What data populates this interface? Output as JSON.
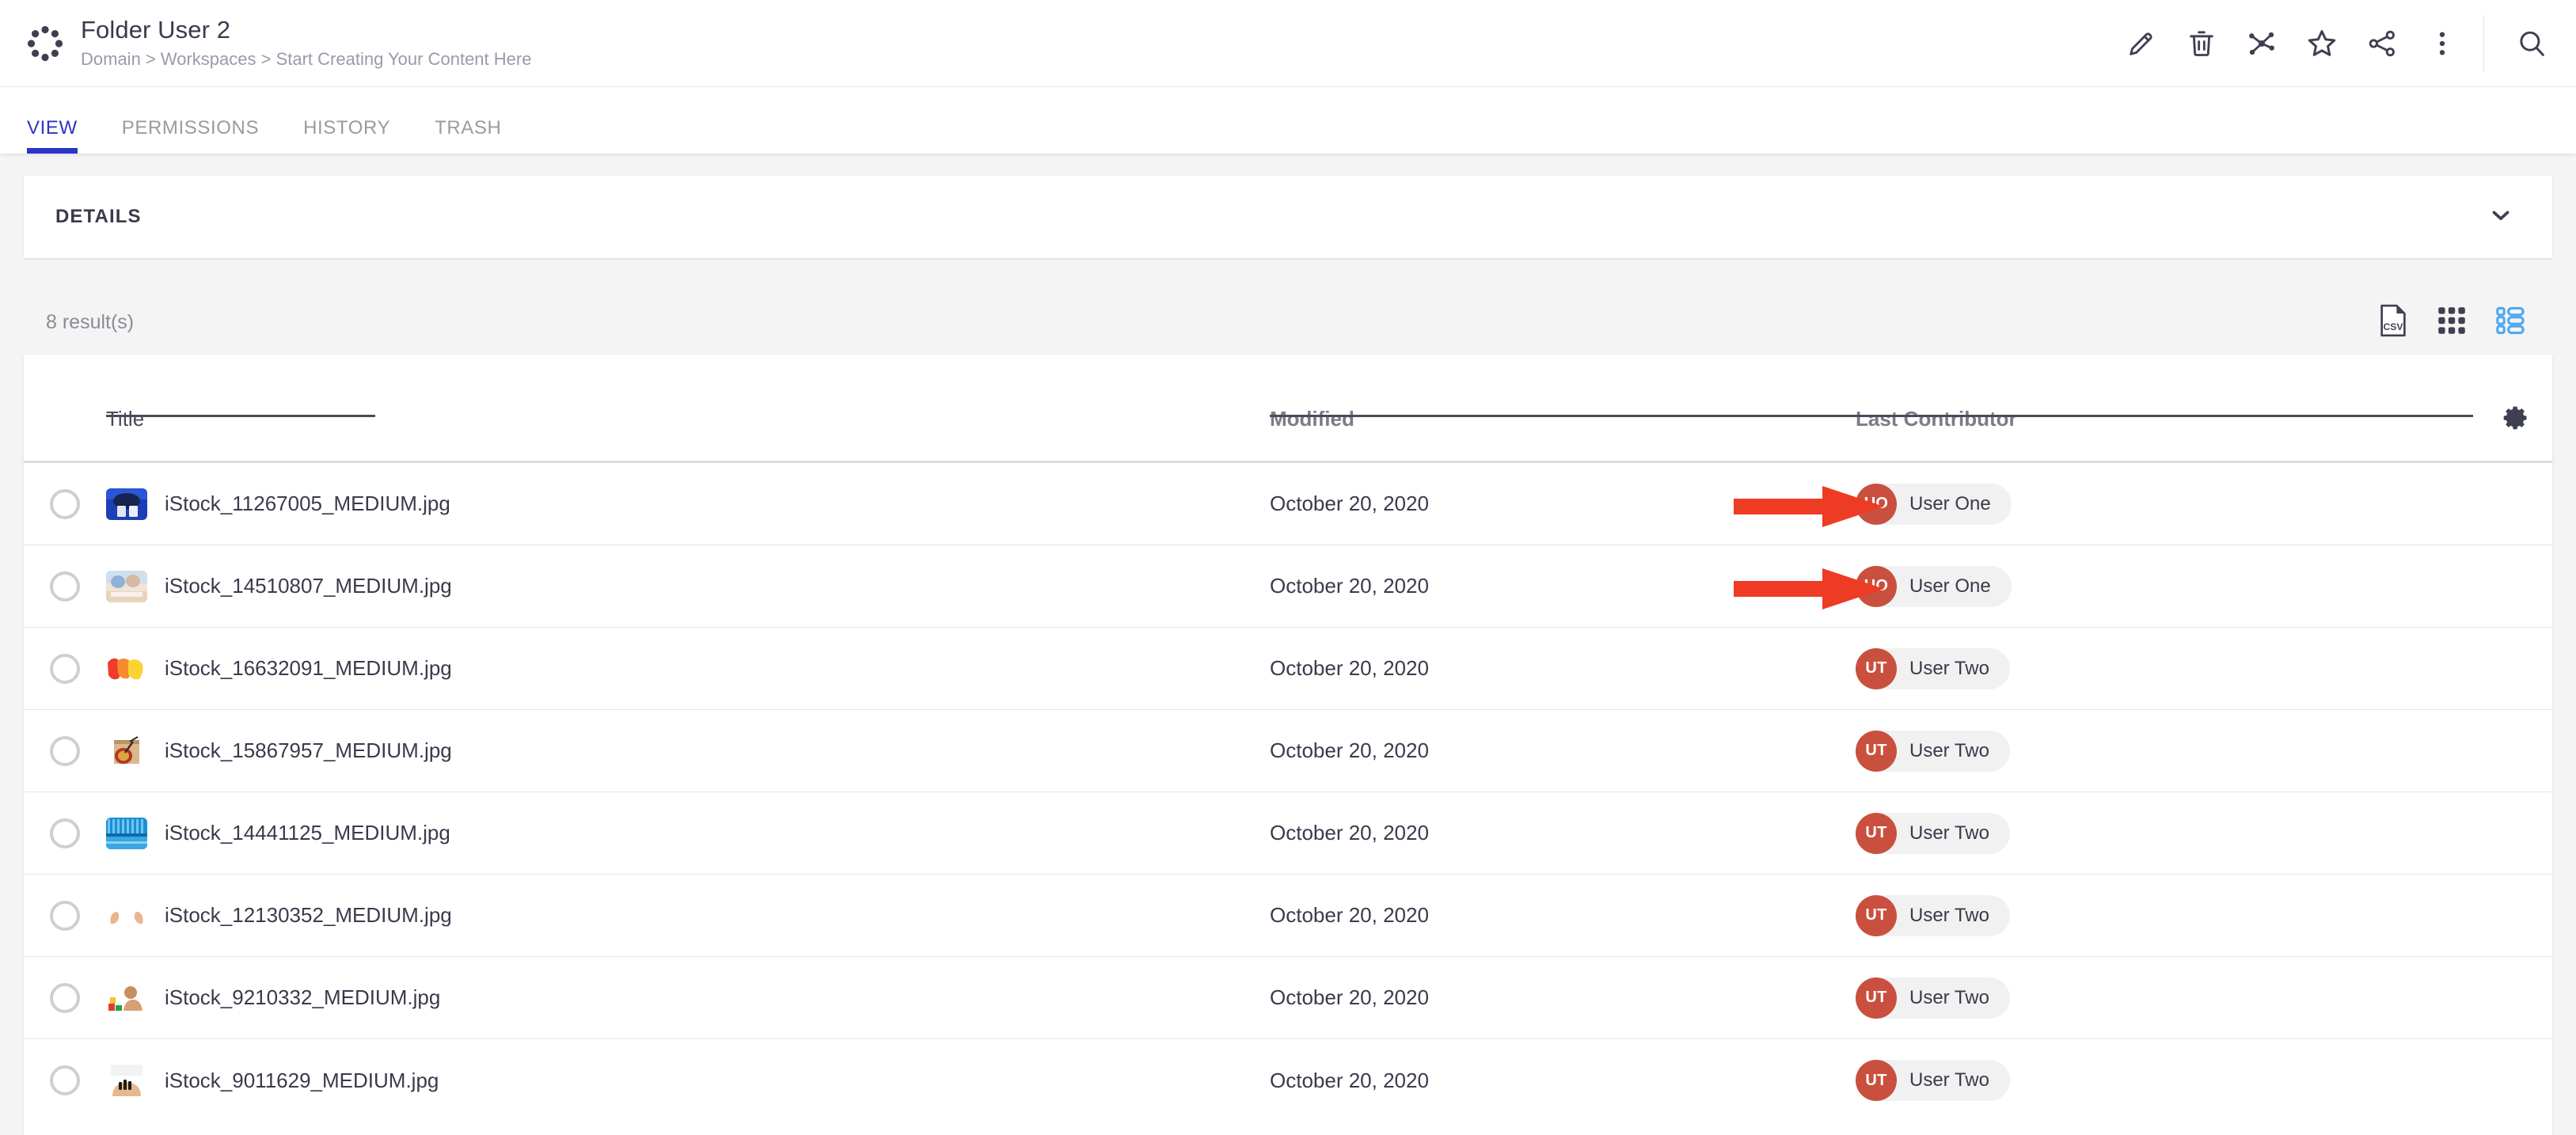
{
  "header": {
    "icon": "workspace-dots-icon",
    "title": "Folder User 2",
    "breadcrumb": "Domain > Workspaces > Start Creating Your Content Here",
    "actions": [
      {
        "name": "edit-button",
        "icon": "pencil-icon",
        "label": "Edit"
      },
      {
        "name": "delete-button",
        "icon": "trash-icon",
        "label": "Delete"
      },
      {
        "name": "relations-button",
        "icon": "network-icon",
        "label": "Relations"
      },
      {
        "name": "favorite-button",
        "icon": "star-icon",
        "label": "Favorite"
      },
      {
        "name": "share-button",
        "icon": "share-icon",
        "label": "Share"
      },
      {
        "name": "more-button",
        "icon": "more-vertical-icon",
        "label": "More"
      },
      {
        "name": "search-button",
        "icon": "search-icon",
        "label": "Search"
      }
    ]
  },
  "tabs": [
    {
      "label": "VIEW",
      "active": true
    },
    {
      "label": "PERMISSIONS",
      "active": false
    },
    {
      "label": "HISTORY",
      "active": false
    },
    {
      "label": "TRASH",
      "active": false
    }
  ],
  "details": {
    "label": "DETAILS",
    "collapse_icon": "chevron-down-icon"
  },
  "results": {
    "count_label": "8 result(s)",
    "tools": [
      {
        "name": "export-csv-button",
        "icon": "csv-file-icon",
        "label": "CSV",
        "active": false
      },
      {
        "name": "grid-view-button",
        "icon": "grid-icon",
        "active": false
      },
      {
        "name": "list-view-button",
        "icon": "list-icon",
        "active": true
      }
    ]
  },
  "table": {
    "columns": [
      {
        "key": "title",
        "label": "Title",
        "sortable": true,
        "underline": true
      },
      {
        "key": "modified",
        "label": "Modified",
        "sortable": true,
        "underline": true
      },
      {
        "key": "contributor",
        "label": "Last Contributor",
        "sortable": true,
        "underline": true
      }
    ],
    "settings_icon": "gear-icon",
    "rows": [
      {
        "title": "iStock_11267005_MEDIUM.jpg",
        "modified": "October 20, 2020",
        "contributor": {
          "initials": "UO",
          "name": "User One"
        },
        "thumb": "dark-blue-objects",
        "annotated": true
      },
      {
        "title": "iStock_14510807_MEDIUM.jpg",
        "modified": "October 20, 2020",
        "contributor": {
          "initials": "UO",
          "name": "User One"
        },
        "thumb": "children-drawing",
        "annotated": true
      },
      {
        "title": "iStock_16632091_MEDIUM.jpg",
        "modified": "October 20, 2020",
        "contributor": {
          "initials": "UT",
          "name": "User Two"
        },
        "thumb": "red-yellow-paint",
        "annotated": false
      },
      {
        "title": "iStock_15867957_MEDIUM.jpg",
        "modified": "October 20, 2020",
        "contributor": {
          "initials": "UT",
          "name": "User Two"
        },
        "thumb": "electric-guitar",
        "annotated": false
      },
      {
        "title": "iStock_14441125_MEDIUM.jpg",
        "modified": "October 20, 2020",
        "contributor": {
          "initials": "UT",
          "name": "User Two"
        },
        "thumb": "blue-building",
        "annotated": false
      },
      {
        "title": "iStock_12130352_MEDIUM.jpg",
        "modified": "October 20, 2020",
        "contributor": {
          "initials": "UT",
          "name": "User Two"
        },
        "thumb": "two-hands",
        "annotated": false
      },
      {
        "title": "iStock_9210332_MEDIUM.jpg",
        "modified": "October 20, 2020",
        "contributor": {
          "initials": "UT",
          "name": "User Two"
        },
        "thumb": "child-blocks",
        "annotated": false
      },
      {
        "title": "iStock_9011629_MEDIUM.jpg",
        "modified": "October 20, 2020",
        "contributor": {
          "initials": "UT",
          "name": "User Two"
        },
        "thumb": "hand-nails",
        "annotated": false
      }
    ]
  },
  "annotations": {
    "arrow_color": "#ee3b24",
    "arrows": [
      {
        "target_row": 0,
        "points_to": "contributor-chip"
      },
      {
        "target_row": 1,
        "points_to": "contributor-chip"
      }
    ]
  },
  "colors": {
    "accent_blue": "#2a35c8",
    "list_active_blue": "#4fa9ee",
    "avatar_red": "#c9503e",
    "arrow_red": "#ee3b24",
    "text_dark": "#3a3a4c",
    "text_muted": "#9a9aa8",
    "page_bg": "#f4f4f4"
  }
}
